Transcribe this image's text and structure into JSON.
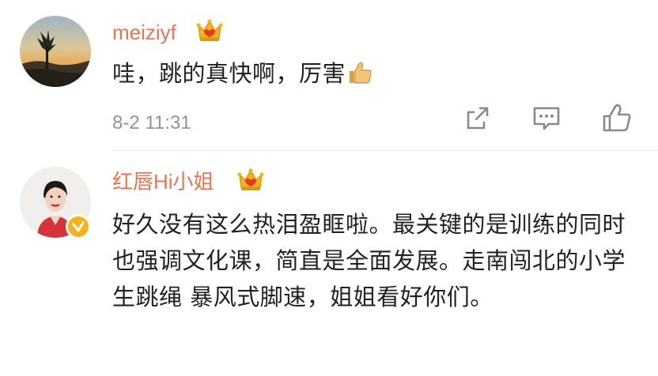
{
  "comments": [
    {
      "username": "meiziyf",
      "text": "哇，跳的真快啊，厉害",
      "time": "8-2 11:31",
      "actions": [
        "share-icon",
        "comment-icon",
        "like-icon"
      ]
    },
    {
      "username": "红唇Hi小姐",
      "text": "好久没有这么热泪盈眶啦。最关键的是训练的同时也强调文化课，简直是全面发展。走南闯北的小学生跳绳 暴风式脚速，姐姐看好你们。"
    }
  ],
  "colors": {
    "username": "#eb7350",
    "body_text": "#222222",
    "meta_text": "#939393",
    "crown_gold": "#f2b51c",
    "verified_badge": "#f6b21b"
  },
  "icons": [
    "crown-badge-icon",
    "thumbs-up-emoji-icon",
    "verified-badge-icon"
  ]
}
